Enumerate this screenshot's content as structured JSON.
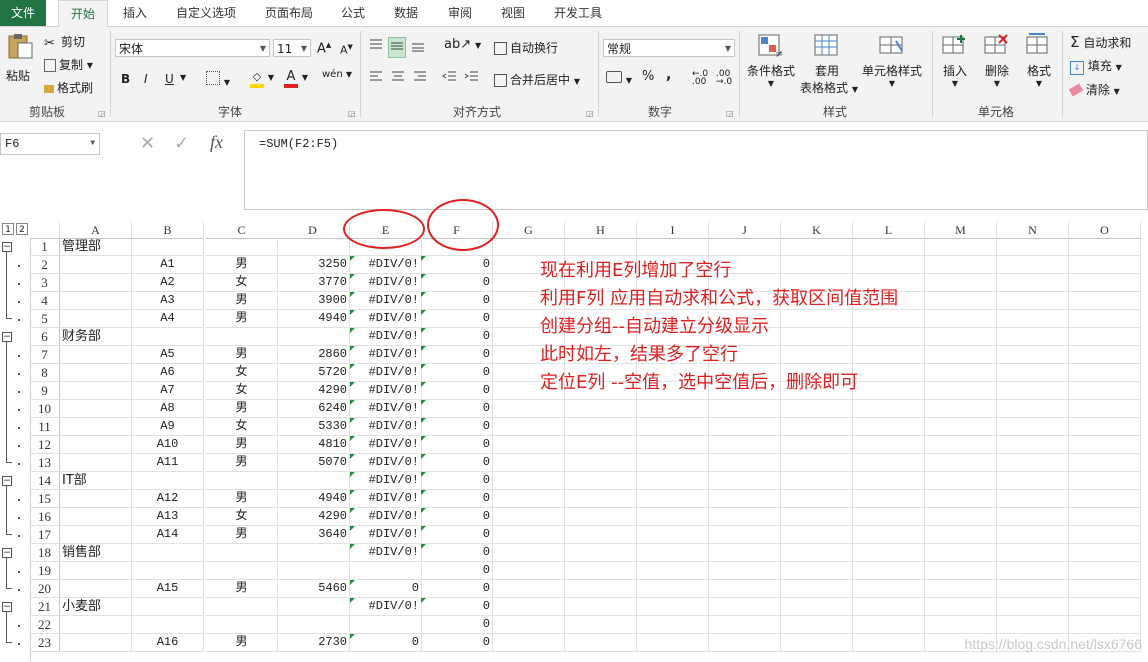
{
  "tabs": [
    "文件",
    "开始",
    "插入",
    "自定义选项",
    "页面布局",
    "公式",
    "数据",
    "审阅",
    "视图",
    "开发工具"
  ],
  "ribbon": {
    "clipboard": {
      "paste": "粘贴",
      "cut": "剪切",
      "copy": "复制",
      "format_painter": "格式刷",
      "label": "剪贴板"
    },
    "font": {
      "font_name": "宋体",
      "font_size": "11",
      "bold": "B",
      "italic": "I",
      "underline": "U",
      "grow": "A",
      "shrink": "A",
      "wen": "wén",
      "label": "字体"
    },
    "alignment": {
      "wrap": "自动换行",
      "merge": "合并后居中",
      "label": "对齐方式"
    },
    "number": {
      "format": "常规",
      "percent": "%",
      "comma": ",",
      "label": "数字"
    },
    "styles": {
      "cond": "条件格式",
      "table1": "套用",
      "table2": "表格格式",
      "cell_style": "单元格样式",
      "label": "样式"
    },
    "cells": {
      "insert": "插入",
      "delete": "删除",
      "format": "格式",
      "label": "单元格"
    },
    "editing": {
      "autosum": "自动求和",
      "fill": "填充",
      "clear": "清除"
    }
  },
  "formula_bar": {
    "name_box": "F6",
    "fx": "fx",
    "formula": "=SUM(F2:F5)"
  },
  "outline_levels": [
    "1",
    "2"
  ],
  "columns": [
    "A",
    "B",
    "C",
    "D",
    "E",
    "F",
    "G",
    "H",
    "I",
    "J",
    "K",
    "L",
    "M",
    "N",
    "O"
  ],
  "rows": [
    {
      "n": "1",
      "a": "管理部",
      "b": "",
      "c": "",
      "d": "",
      "e": "",
      "f": ""
    },
    {
      "n": "2",
      "a": "",
      "b": "A1",
      "c": "男",
      "d": "3250",
      "e": "#DIV/0!",
      "f": "0"
    },
    {
      "n": "3",
      "a": "",
      "b": "A2",
      "c": "女",
      "d": "3770",
      "e": "#DIV/0!",
      "f": "0"
    },
    {
      "n": "4",
      "a": "",
      "b": "A3",
      "c": "男",
      "d": "3900",
      "e": "#DIV/0!",
      "f": "0"
    },
    {
      "n": "5",
      "a": "",
      "b": "A4",
      "c": "男",
      "d": "4940",
      "e": "#DIV/0!",
      "f": "0"
    },
    {
      "n": "6",
      "a": "财务部",
      "b": "",
      "c": "",
      "d": "",
      "e": "#DIV/0!",
      "f": "0"
    },
    {
      "n": "7",
      "a": "",
      "b": "A5",
      "c": "男",
      "d": "2860",
      "e": "#DIV/0!",
      "f": "0"
    },
    {
      "n": "8",
      "a": "",
      "b": "A6",
      "c": "女",
      "d": "5720",
      "e": "#DIV/0!",
      "f": "0"
    },
    {
      "n": "9",
      "a": "",
      "b": "A7",
      "c": "女",
      "d": "4290",
      "e": "#DIV/0!",
      "f": "0"
    },
    {
      "n": "10",
      "a": "",
      "b": "A8",
      "c": "男",
      "d": "6240",
      "e": "#DIV/0!",
      "f": "0"
    },
    {
      "n": "11",
      "a": "",
      "b": "A9",
      "c": "女",
      "d": "5330",
      "e": "#DIV/0!",
      "f": "0"
    },
    {
      "n": "12",
      "a": "",
      "b": "A10",
      "c": "男",
      "d": "4810",
      "e": "#DIV/0!",
      "f": "0"
    },
    {
      "n": "13",
      "a": "",
      "b": "A11",
      "c": "男",
      "d": "5070",
      "e": "#DIV/0!",
      "f": "0"
    },
    {
      "n": "14",
      "a": "IT部",
      "b": "",
      "c": "",
      "d": "",
      "e": "#DIV/0!",
      "f": "0"
    },
    {
      "n": "15",
      "a": "",
      "b": "A12",
      "c": "男",
      "d": "4940",
      "e": "#DIV/0!",
      "f": "0"
    },
    {
      "n": "16",
      "a": "",
      "b": "A13",
      "c": "女",
      "d": "4290",
      "e": "#DIV/0!",
      "f": "0"
    },
    {
      "n": "17",
      "a": "",
      "b": "A14",
      "c": "男",
      "d": "3640",
      "e": "#DIV/0!",
      "f": "0"
    },
    {
      "n": "18",
      "a": "销售部",
      "b": "",
      "c": "",
      "d": "",
      "e": "#DIV/0!",
      "f": "0"
    },
    {
      "n": "19",
      "a": "",
      "b": "",
      "c": "",
      "d": "",
      "e": "",
      "f": "0"
    },
    {
      "n": "20",
      "a": "",
      "b": "A15",
      "c": "男",
      "d": "5460",
      "e": "0",
      "f": "0"
    },
    {
      "n": "21",
      "a": "小麦部",
      "b": "",
      "c": "",
      "d": "",
      "e": "#DIV/0!",
      "f": "0"
    },
    {
      "n": "22",
      "a": "",
      "b": "",
      "c": "",
      "d": "",
      "e": "",
      "f": "0"
    },
    {
      "n": "23",
      "a": "",
      "b": "A16",
      "c": "男",
      "d": "2730",
      "e": "0",
      "f": "0"
    }
  ],
  "notes": [
    "现在利用E列增加了空行",
    "利用F列 应用自动求和公式，获取区间值范围",
    "创建分组--自动建立分级显示",
    "此时如左，结果多了空行",
    "定位E列  --空值，选中空值后，删除即可"
  ],
  "watermark": "https://blog.csdn.net/lsx6766",
  "colors": {
    "excel_green": "#217346",
    "annotation_red": "#e02020",
    "error_marker": "#1e8e3e"
  }
}
